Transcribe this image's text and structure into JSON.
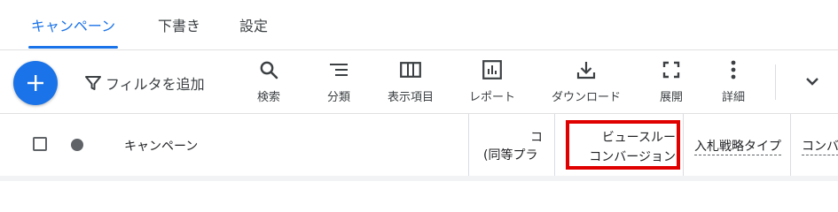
{
  "tabs": [
    {
      "label": "キャンペーン",
      "active": true
    },
    {
      "label": "下書き",
      "active": false
    },
    {
      "label": "設定",
      "active": false
    }
  ],
  "toolbar": {
    "add_icon": "plus-icon",
    "filter_label": "フィルタを追加",
    "tools": [
      {
        "label": "検索",
        "icon": "search-icon"
      },
      {
        "label": "分類",
        "icon": "segment-icon"
      },
      {
        "label": "表示項目",
        "icon": "columns-icon"
      },
      {
        "label": "レポート",
        "icon": "reports-icon"
      },
      {
        "label": "ダウンロード",
        "icon": "download-icon"
      },
      {
        "label": "展開",
        "icon": "expand-icon"
      },
      {
        "label": "詳細",
        "icon": "more-vert-icon"
      }
    ],
    "chevron_icon": "chevron-down-icon"
  },
  "table_header": {
    "campaign_label": "キャンペーン",
    "col_conversions_line1": "コ",
    "col_conversions_line2": "(同等プラ",
    "col_view_through_line1": "ビュースルー",
    "col_view_through_line2": "コンバージョン",
    "col_bid_strategy": "入札戦略タイプ",
    "col_conversion_next": "コンバ"
  },
  "colors": {
    "accent": "#1a73e8",
    "highlight_box": "#e00000"
  }
}
